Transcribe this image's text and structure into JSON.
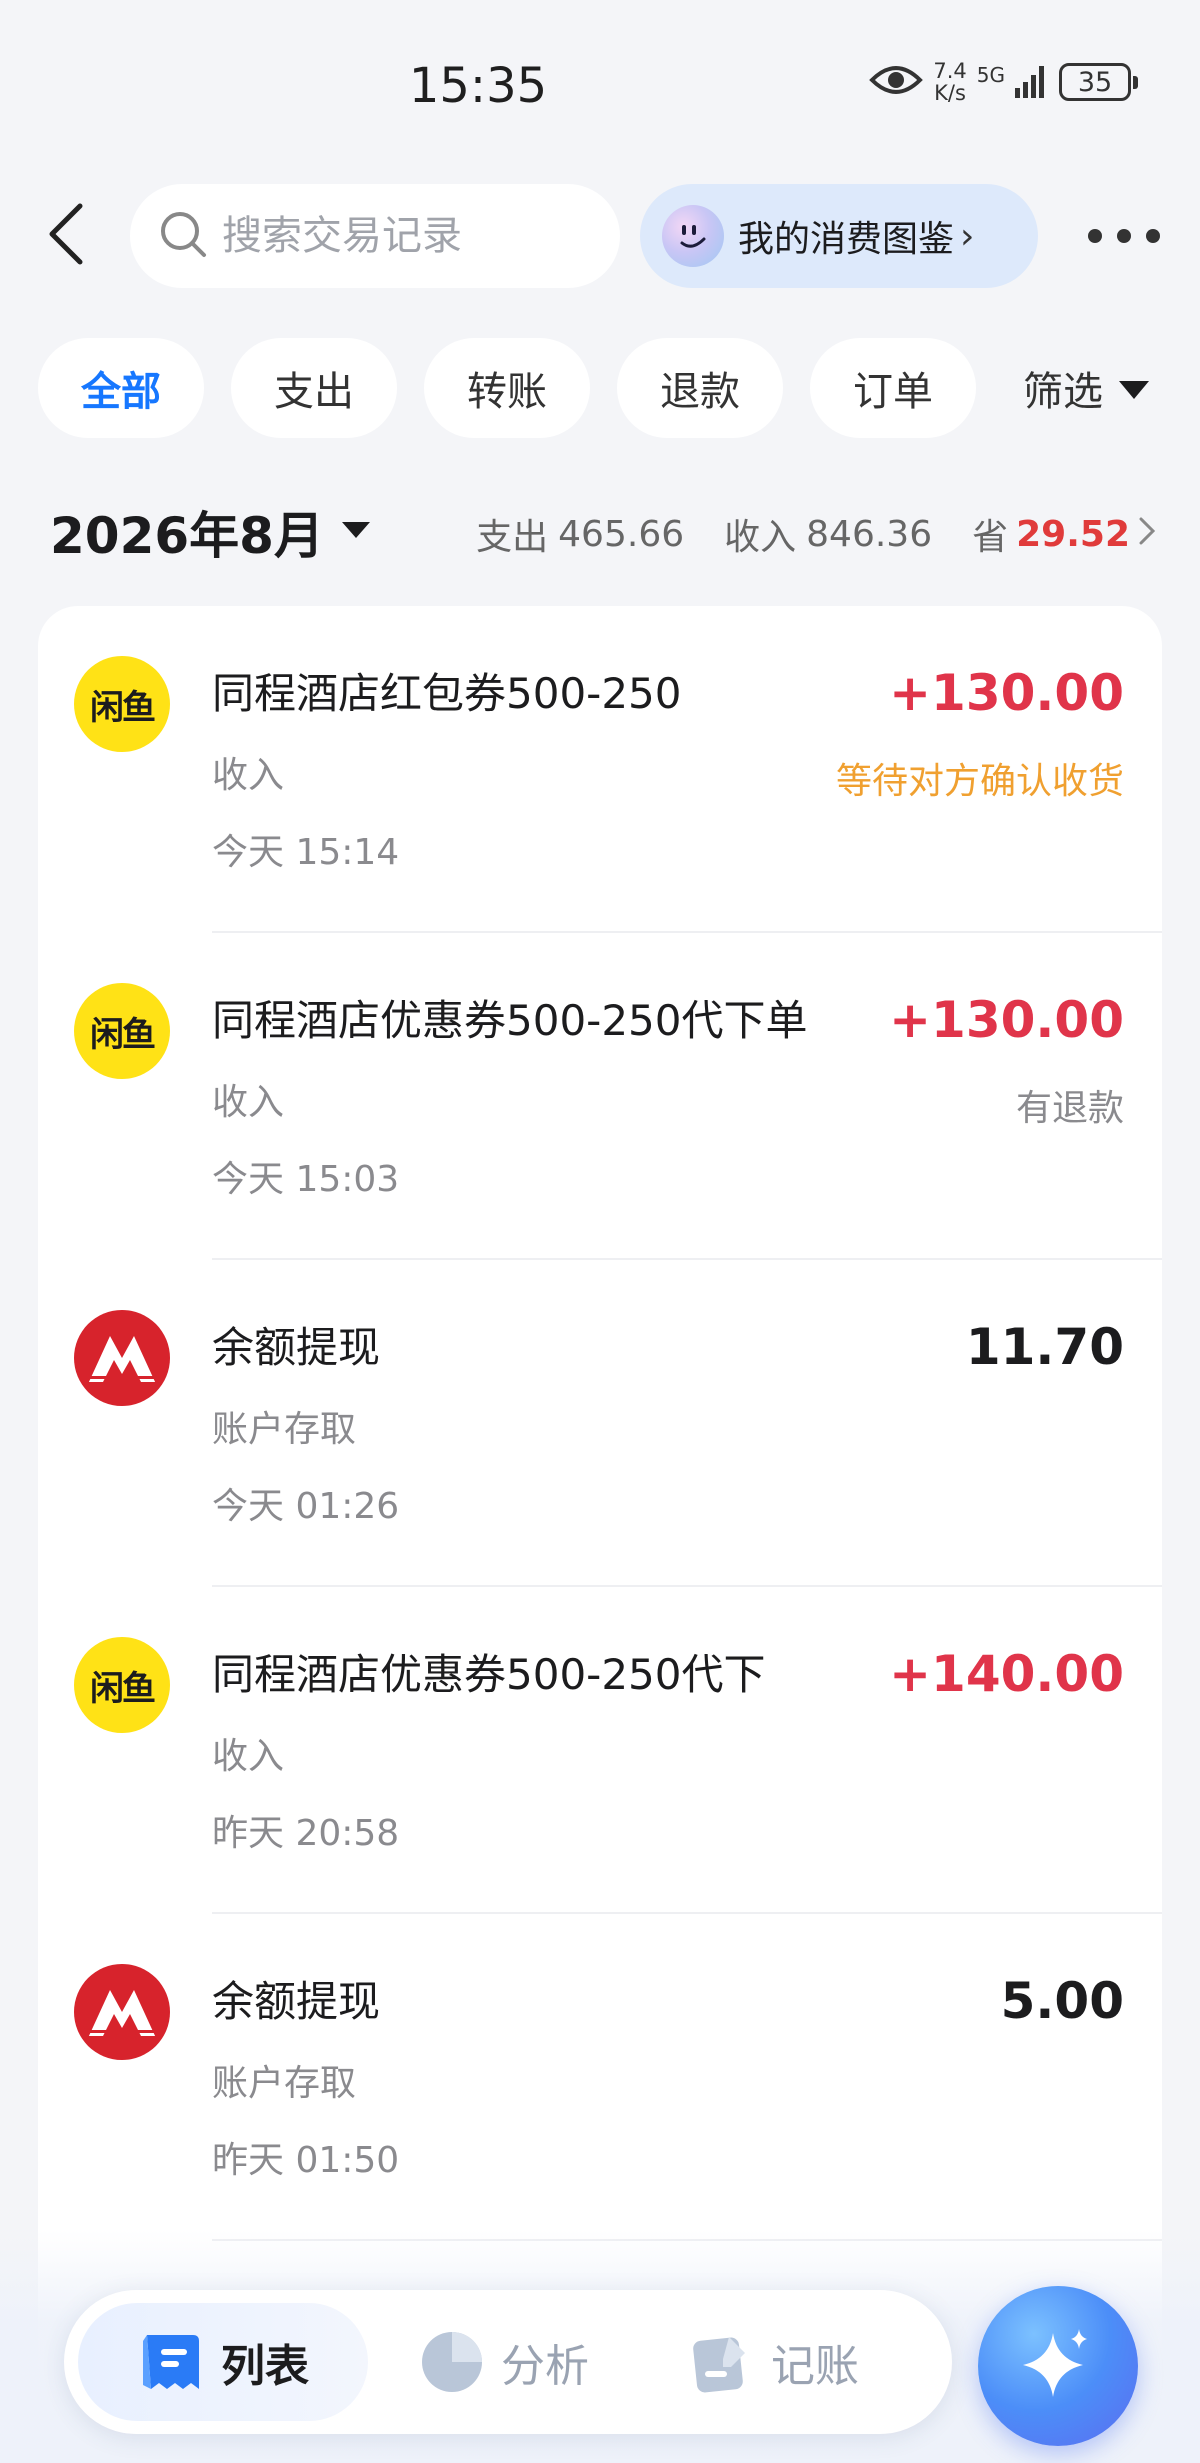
{
  "status_bar": {
    "time": "15:35",
    "net_speed_value": "7.4",
    "net_speed_unit": "K/s",
    "network": "5G",
    "battery": "35"
  },
  "header": {
    "search_placeholder": "搜索交易记录",
    "spending_pill_label": "我的消费图鉴",
    "pill_arrow": "›"
  },
  "filters": {
    "chips": [
      "全部",
      "支出",
      "转账",
      "退款",
      "订单"
    ],
    "active_index": 0,
    "filter_label": "筛选"
  },
  "month_summary": {
    "month": "2026年8月",
    "expense_label": "支出",
    "expense_value": "465.66",
    "income_label": "收入",
    "income_value": "846.36",
    "saved_label": "省",
    "saved_value": "29.52",
    "saved_color": "#e03b3b"
  },
  "transactions": [
    {
      "icon": "xianyu-logo-icon",
      "logo_text": "闲鱼",
      "title": "同程酒店红包券500-250",
      "category": "收入",
      "time": "今天 15:14",
      "amount": "+130.00",
      "amount_type": "income",
      "status": "等待对方确认收货",
      "status_type": "pending"
    },
    {
      "icon": "xianyu-logo-icon",
      "logo_text": "闲鱼",
      "title": "同程酒店优惠券500-250代下单",
      "category": "收入",
      "time": "今天 15:03",
      "amount": "+130.00",
      "amount_type": "income",
      "status": "有退款",
      "status_type": "normal"
    },
    {
      "icon": "cmb-bank-logo-icon",
      "title": "余额提现",
      "category": "账户存取",
      "time": "今天 01:26",
      "amount": "11.70",
      "amount_type": "neutral",
      "status": "",
      "status_type": "none"
    },
    {
      "icon": "xianyu-logo-icon",
      "logo_text": "闲鱼",
      "title": "同程酒店优惠券500-250代下",
      "category": "收入",
      "time": "昨天 20:58",
      "amount": "+140.00",
      "amount_type": "income",
      "status": "",
      "status_type": "none"
    },
    {
      "icon": "cmb-bank-logo-icon",
      "title": "余额提现",
      "category": "账户存取",
      "time": "昨天 01:50",
      "amount": "5.00",
      "amount_type": "neutral",
      "status": "",
      "status_type": "none"
    }
  ],
  "bottom_nav": {
    "items": [
      {
        "label": "列表",
        "icon": "list-icon",
        "active": true
      },
      {
        "label": "分析",
        "icon": "pie-chart-icon",
        "active": false
      },
      {
        "label": "记账",
        "icon": "bookkeeping-icon",
        "active": false
      }
    ],
    "ai_button_icon": "sparkle-icon"
  },
  "colors": {
    "accent": "#1677ff",
    "income": "#e0344a",
    "pending": "#f0a030",
    "xianyu_yellow": "#ffe216",
    "cmb_red": "#d7232c"
  }
}
